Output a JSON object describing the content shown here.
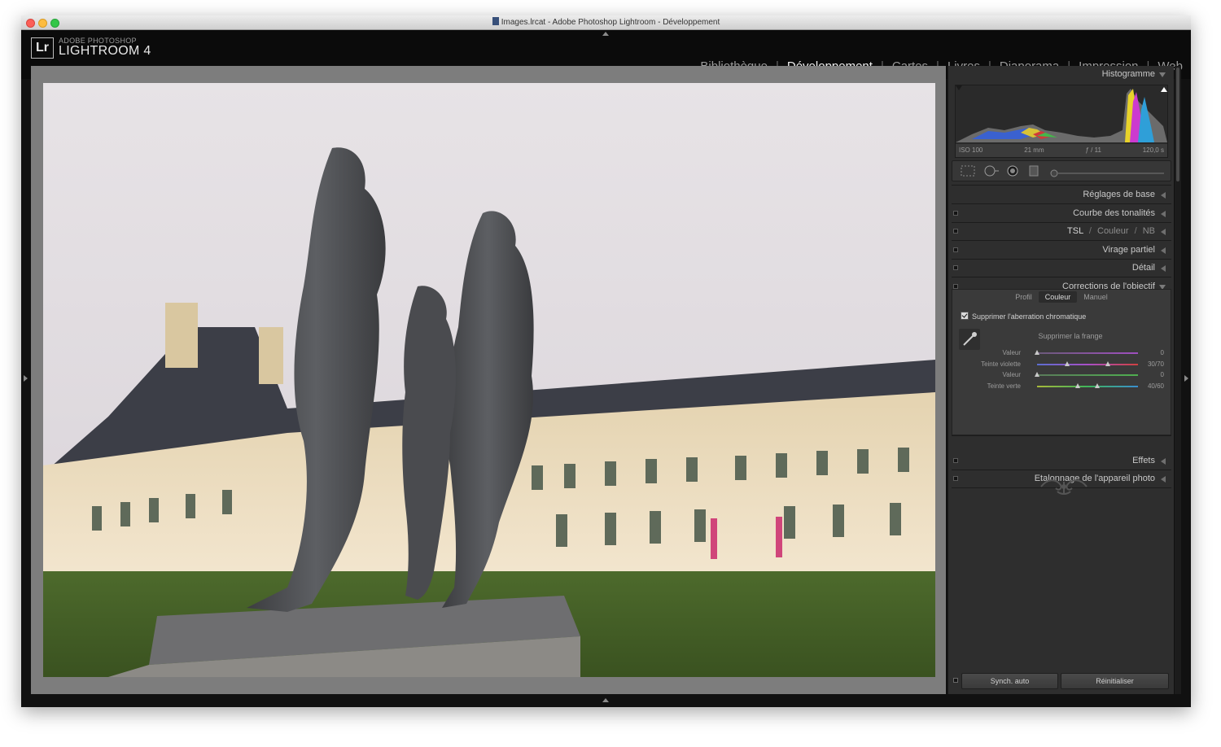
{
  "window": {
    "title": "Images.lrcat - Adobe Photoshop Lightroom - Développement",
    "traffic_lights": [
      "#fc5f57",
      "#fdbc40",
      "#33c748"
    ]
  },
  "brand": {
    "badge": "Lr",
    "small": "ADOBE PHOTOSHOP",
    "big": "LIGHTROOM 4"
  },
  "modules": [
    {
      "label": "Bibliothèque",
      "active": false
    },
    {
      "label": "Développement",
      "active": true
    },
    {
      "label": "Cartes",
      "active": false
    },
    {
      "label": "Livres",
      "active": false
    },
    {
      "label": "Diaporama",
      "active": false
    },
    {
      "label": "Impression",
      "active": false
    },
    {
      "label": "Web",
      "active": false
    }
  ],
  "module_separator": "|",
  "panel": {
    "histogram": {
      "title": "Histogramme",
      "iso": "ISO 100",
      "focal": "21 mm",
      "aperture": "ƒ / 11",
      "shutter": "120,0 s"
    },
    "sections": {
      "basic": "Réglages de base",
      "tone_curve": "Courbe des tonalités",
      "hsl": "TSL",
      "hsl_sep": "/",
      "color": "Couleur",
      "bw": "NB",
      "split": "Virage partiel",
      "detail": "Détail",
      "lens": "Corrections de l'objectif",
      "effects": "Effets",
      "calibration": "Etalonnage de l'appareil photo"
    },
    "lens": {
      "tabs": [
        "Profil",
        "Couleur",
        "Manuel"
      ],
      "selected_tab": "Couleur",
      "checkbox_label": "Supprimer l'aberration chromatique",
      "defringe_title": "Supprimer la frange",
      "sliders": [
        {
          "label": "Valeur",
          "value": "0",
          "knobs": [
            0.0
          ]
        },
        {
          "label": "Teinte violette",
          "value": "30/70",
          "knobs": [
            0.3,
            0.7
          ]
        },
        {
          "label": "Valeur",
          "value": "0",
          "knobs": [
            0.0
          ]
        },
        {
          "label": "Teinte verte",
          "value": "40/60",
          "knobs": [
            0.4,
            0.6
          ]
        }
      ]
    },
    "buttons": {
      "sync": "Synch. auto",
      "reset": "Réinitialiser"
    }
  }
}
